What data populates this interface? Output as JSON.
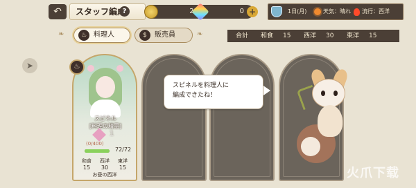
{
  "header": {
    "back_icon": "back-arrow-icon",
    "title": "スタッフ編成",
    "help": "?"
  },
  "currencies": [
    {
      "icon": "coin-icon",
      "value": "25"
    },
    {
      "icon": "gem-icon",
      "value": "0"
    }
  ],
  "info": {
    "day": "1日(月)",
    "weather": "天気：晴れ",
    "trend": "流行：西洋"
  },
  "tabs": [
    {
      "icon": "cooking-pot-icon",
      "label": "料理人",
      "selected": true
    },
    {
      "icon": "money-bag-icon",
      "label": "販売員",
      "selected": false
    }
  ],
  "totals": {
    "label": "合計",
    "items": [
      {
        "label": "和食",
        "value": "15"
      },
      {
        "label": "西洋",
        "value": "30"
      },
      {
        "label": "東洋",
        "value": "15"
      }
    ]
  },
  "staff_card": {
    "name_line1": "スピネル",
    "name_line2": "[料理の精霊]",
    "hearts": "1",
    "affection": "(0/400)",
    "hp": "72/72",
    "hp_fraction": 1.0,
    "stats": [
      {
        "label": "和食",
        "value": "15"
      },
      {
        "label": "西洋",
        "value": "30"
      },
      {
        "label": "東洋",
        "value": "15"
      }
    ],
    "footer": "お昼の西洋"
  },
  "bubble": {
    "line1": "スピネルを料理人に",
    "line2": "編成できたね！"
  },
  "watermark": "火爪下载",
  "colors": {
    "dark_panel": "#4b3f36",
    "gold": "#c5a66a",
    "hp_green": "#8ad15c"
  }
}
